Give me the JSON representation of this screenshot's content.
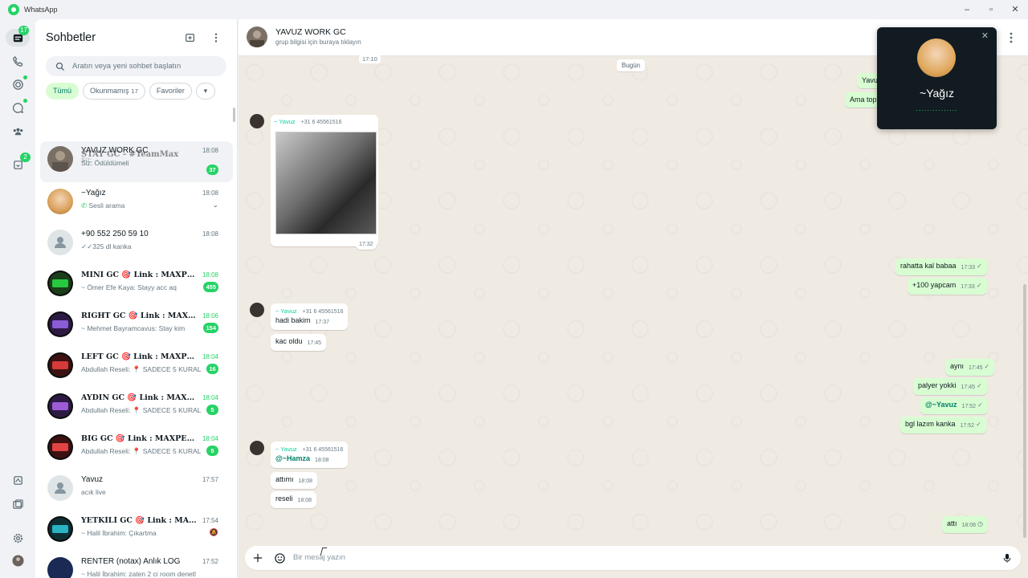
{
  "app_title": "WhatsApp",
  "rail": {
    "chats_badge": "17",
    "updates_badge": "2"
  },
  "sidebar": {
    "title": "Sohbetler",
    "search_placeholder": "Aratın veya yeni sohbet başlatın",
    "chips": [
      {
        "label": "Tümü",
        "count": ""
      },
      {
        "label": "Okunmamış",
        "count": "17"
      },
      {
        "label": "Favoriler",
        "count": ""
      }
    ],
    "chats": [
      {
        "name": "YAVUZ WORK GC",
        "preview": "Siz: Ödüldümeli",
        "time": "18:08",
        "badge": "37",
        "overlay_name": "STAY GC - #TeamMax",
        "overlay_preview": "Siz:"
      },
      {
        "name": "~Yağız",
        "preview": "Sesli arama",
        "time": "18:08",
        "badge": ""
      },
      {
        "name": "+90 552 250 59 10",
        "preview": "325 dl kanka",
        "time": "18:08",
        "badge": ""
      },
      {
        "name": "MINI GC 🎯 Link : MAXPEP71",
        "preview": "~ Ömer Efe Kaya: Stayy acc aq",
        "time": "18:08",
        "badge": "455"
      },
      {
        "name": "RIGHT GC 🎯 Link : MAXPEP71",
        "preview": "~ Mehmet Bayramcavus: Stay kim",
        "time": "18:06",
        "badge": "154"
      },
      {
        "name": "LEFT GC 🎯 Link : MAXPEP71",
        "preview": "Abdullah Reseli: 📍 SADECE 5 KURAL",
        "time": "18:04",
        "badge": "16"
      },
      {
        "name": "AYDIN GC 🎯 Link : MAXPEP71",
        "preview": "Abdullah Reseli: 📍 SADECE 5 KURAL",
        "time": "18:04",
        "badge": "5"
      },
      {
        "name": "BIG GC 🎯 Link : MAXPEP71",
        "preview": "Abdullah Reseli: 📍 SADECE 5 KURAL",
        "time": "18:04",
        "badge": "5"
      },
      {
        "name": "Yavuz",
        "preview": "acık live",
        "time": "17:57",
        "badge": ""
      },
      {
        "name": "YETKİLİ GC 🎯 Link : MAXPEP71",
        "preview": "~ Halil İbrahim: Çıkartma",
        "time": "17:54",
        "badge": ""
      },
      {
        "name": "RENTER (notax) Anlık LOG",
        "preview": "~ Halil İbrahim: zaten 2 ci room denetl",
        "time": "17:52",
        "badge": ""
      }
    ]
  },
  "header": {
    "name": "YAVUZ WORK GC",
    "subtitle": "grup bilgisi için buraya tıklayın"
  },
  "messages": {
    "top_time": "17:10",
    "date_sep": "Bugün",
    "out_partial_1": "Yavu",
    "out_partial_2": "Ama top",
    "group1_sender": "~ Yavuz",
    "group1_phone": "+31 6 45561516",
    "photo_time": "17:32",
    "out1": {
      "text": "rahatta kal babaa",
      "time": "17:33"
    },
    "out2": {
      "text": "+100 yapcam",
      "time": "17:33"
    },
    "group2_sender": "~ Yavuz",
    "group2_phone": "+31 6 45561516",
    "in1": {
      "text": "hadi bakim",
      "time": "17:37"
    },
    "in2": {
      "text": "kac oldu",
      "time": "17:45"
    },
    "out3": {
      "text": "aynı",
      "time": "17:45"
    },
    "out4": {
      "text": "palyer yokki",
      "time": "17:45"
    },
    "out5": {
      "text": "@~Yavuz",
      "time": "17:52"
    },
    "out6": {
      "text": "bgl lazım kanka",
      "time": "17:52"
    },
    "group3_sender": "~ Yavuz",
    "group3_phone": "+31 6 45561516",
    "in3": {
      "text": "@~Hamza",
      "time": "18:08"
    },
    "in4": {
      "text": "attımı",
      "time": "18:08"
    },
    "in5": {
      "text": "reseli",
      "time": "18:08"
    },
    "out7": {
      "text": "attı",
      "time": "18:08"
    }
  },
  "composer": {
    "placeholder": "Bir mesaj yazın"
  },
  "call": {
    "name": "~Yağız",
    "status": "..............."
  }
}
